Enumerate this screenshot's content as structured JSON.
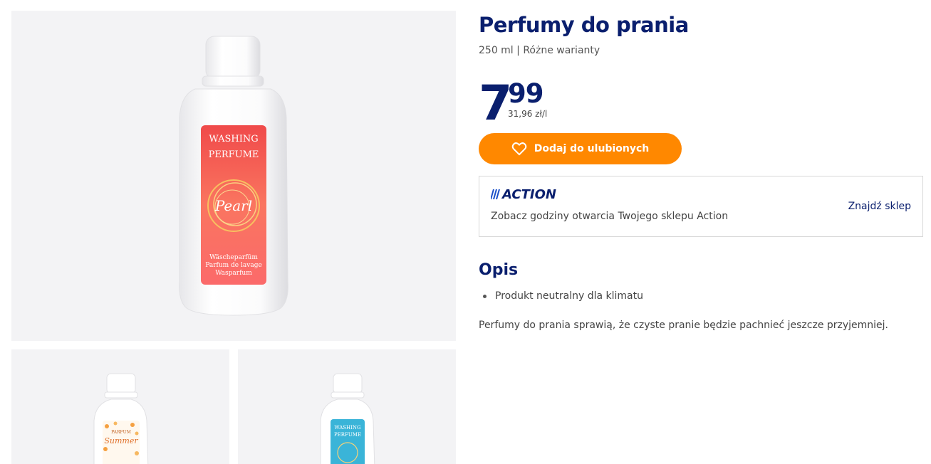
{
  "product": {
    "title": "Perfumy do prania",
    "subtitle": "250 ml | Różne warianty",
    "price_integer": "7",
    "price_decimal": "99",
    "price_per_unit": "31,96 zł/l"
  },
  "favorite_button": {
    "label": "Dodaj do ulubionych",
    "icon": "heart-icon",
    "color": "#ff8800"
  },
  "store": {
    "brand": "ACTION",
    "opening_hours_text": "Zobacz godziny otwarcia Twojego sklepu Action",
    "find_store_label": "Znajdź sklep"
  },
  "description": {
    "heading": "Opis",
    "bullets": [
      "Produkt neutralny dla klimatu"
    ],
    "text": "Perfumy do prania sprawią, że czyste pranie będzie pachnieć jeszcze przyjemniej."
  },
  "main_image": {
    "label_line1": "WASHING",
    "label_line2": "PERFUME",
    "scent": "Pearl",
    "lang1": "Wäscheparfüm",
    "lang2": "Parfum de lavage",
    "lang3": "Wasparfum"
  },
  "thumbnails": [
    {
      "label_line1": "PARFUM",
      "scent": "Summer"
    },
    {
      "label_line1": "WASHING",
      "label_line2": "PERFUME"
    }
  ],
  "colors": {
    "brand_navy": "#0a1f6e",
    "accent_orange": "#ff8800",
    "image_bg": "#f3f3f5"
  }
}
